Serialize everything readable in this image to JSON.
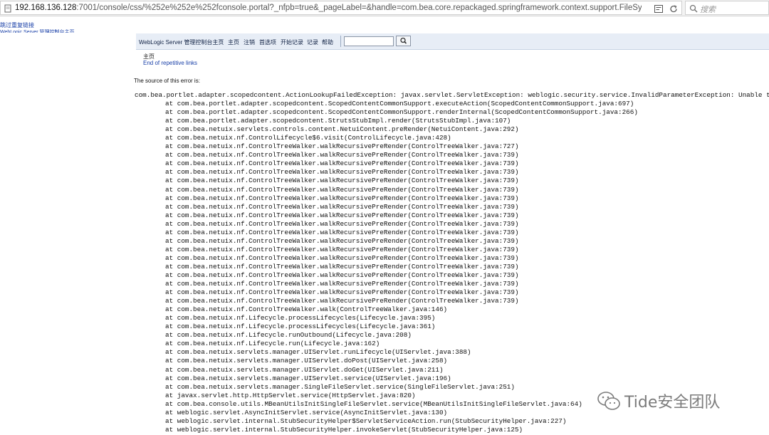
{
  "browser": {
    "url_host": "192.168.136.128",
    "url_rest": ":7001/console/css/%252e%252e%252fconsole.portal?_nfpb=true&_pageLabel=&handle=com.bea.core.repackaged.springframework.context.support.FileSyste",
    "search_placeholder": "搜索"
  },
  "skip_links": {
    "skip": "跳过重复链接",
    "console_home": "WebLogic Server 管理控制台主页"
  },
  "toolbar": {
    "title": "WebLogic Server 管理控制台主页",
    "home": "主页",
    "logout": "注销",
    "preferences": "首选项",
    "record": "开始记录",
    "log": "记录",
    "help": "帮助"
  },
  "breadcrumb": "主页",
  "end_repetitive": "End of repetitive links",
  "source_label": "The source of this error is:",
  "exception": "com.bea.portlet.adapter.scopedcontent.ActionLookupFailedException: javax.servlet.ServletException: weblogic.security.service.InvalidParameterException: Unable to instanc",
  "frames": [
    "at com.bea.portlet.adapter.scopedcontent.ScopedContentCommonSupport.executeAction(ScopedContentCommonSupport.java:697)",
    "at com.bea.portlet.adapter.scopedcontent.ScopedContentCommonSupport.renderInternal(ScopedContentCommonSupport.java:266)",
    "at com.bea.portlet.adapter.scopedcontent.StrutsStubImpl.render(StrutsStubImpl.java:107)",
    "at com.bea.netuix.servlets.controls.content.NetuiContent.preRender(NetuiContent.java:292)",
    "at com.bea.netuix.nf.ControlLifecycle$6.visit(ControlLifecycle.java:428)",
    "at com.bea.netuix.nf.ControlTreeWalker.walkRecursivePreRender(ControlTreeWalker.java:727)",
    "at com.bea.netuix.nf.ControlTreeWalker.walkRecursivePreRender(ControlTreeWalker.java:739)",
    "at com.bea.netuix.nf.ControlTreeWalker.walkRecursivePreRender(ControlTreeWalker.java:739)",
    "at com.bea.netuix.nf.ControlTreeWalker.walkRecursivePreRender(ControlTreeWalker.java:739)",
    "at com.bea.netuix.nf.ControlTreeWalker.walkRecursivePreRender(ControlTreeWalker.java:739)",
    "at com.bea.netuix.nf.ControlTreeWalker.walkRecursivePreRender(ControlTreeWalker.java:739)",
    "at com.bea.netuix.nf.ControlTreeWalker.walkRecursivePreRender(ControlTreeWalker.java:739)",
    "at com.bea.netuix.nf.ControlTreeWalker.walkRecursivePreRender(ControlTreeWalker.java:739)",
    "at com.bea.netuix.nf.ControlTreeWalker.walkRecursivePreRender(ControlTreeWalker.java:739)",
    "at com.bea.netuix.nf.ControlTreeWalker.walkRecursivePreRender(ControlTreeWalker.java:739)",
    "at com.bea.netuix.nf.ControlTreeWalker.walkRecursivePreRender(ControlTreeWalker.java:739)",
    "at com.bea.netuix.nf.ControlTreeWalker.walkRecursivePreRender(ControlTreeWalker.java:739)",
    "at com.bea.netuix.nf.ControlTreeWalker.walkRecursivePreRender(ControlTreeWalker.java:739)",
    "at com.bea.netuix.nf.ControlTreeWalker.walkRecursivePreRender(ControlTreeWalker.java:739)",
    "at com.bea.netuix.nf.ControlTreeWalker.walkRecursivePreRender(ControlTreeWalker.java:739)",
    "at com.bea.netuix.nf.ControlTreeWalker.walkRecursivePreRender(ControlTreeWalker.java:739)",
    "at com.bea.netuix.nf.ControlTreeWalker.walkRecursivePreRender(ControlTreeWalker.java:739)",
    "at com.bea.netuix.nf.ControlTreeWalker.walkRecursivePreRender(ControlTreeWalker.java:739)",
    "at com.bea.netuix.nf.ControlTreeWalker.walkRecursivePreRender(ControlTreeWalker.java:739)",
    "at com.bea.netuix.nf.ControlTreeWalker.walk(ControlTreeWalker.java:146)",
    "at com.bea.netuix.nf.Lifecycle.processLifecycles(Lifecycle.java:395)",
    "at com.bea.netuix.nf.Lifecycle.processLifecycles(Lifecycle.java:361)",
    "at com.bea.netuix.nf.Lifecycle.runOutbound(Lifecycle.java:208)",
    "at com.bea.netuix.nf.Lifecycle.run(Lifecycle.java:162)",
    "at com.bea.netuix.servlets.manager.UIServlet.runLifecycle(UIServlet.java:388)",
    "at com.bea.netuix.servlets.manager.UIServlet.doPost(UIServlet.java:258)",
    "at com.bea.netuix.servlets.manager.UIServlet.doGet(UIServlet.java:211)",
    "at com.bea.netuix.servlets.manager.UIServlet.service(UIServlet.java:196)",
    "at com.bea.netuix.servlets.manager.SingleFileServlet.service(SingleFileServlet.java:251)",
    "at javax.servlet.http.HttpServlet.service(HttpServlet.java:820)",
    "at com.bea.console.utils.MBeanUtilsInitSingleFileServlet.service(MBeanUtilsInitSingleFileServlet.java:64)",
    "at weblogic.servlet.AsyncInitServlet.service(AsyncInitServlet.java:130)",
    "at weblogic.servlet.internal.StubSecurityHelper$ServletServiceAction.run(StubSecurityHelper.java:227)",
    "at weblogic.servlet.internal.StubSecurityHelper.invokeServlet(StubSecurityHelper.java:125)"
  ],
  "watermark": "Tide安全团队"
}
